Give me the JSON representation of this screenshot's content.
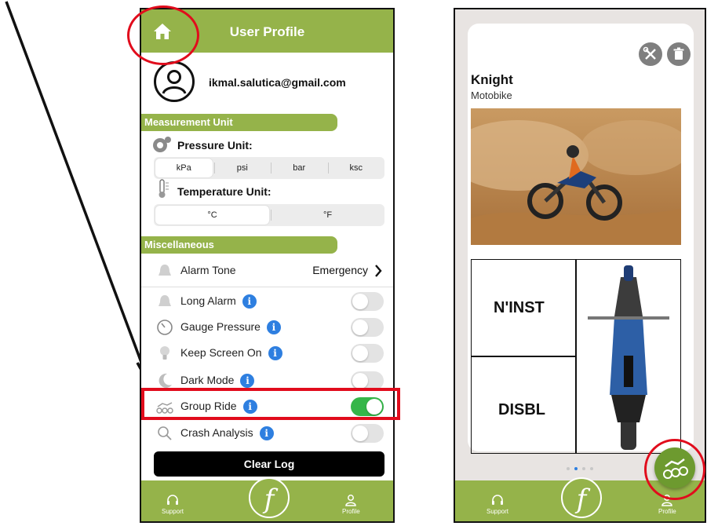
{
  "profile": {
    "header_title": "User Profile",
    "email": "ikmal.salutica@gmail.com",
    "measurement_section": "Measurement Unit",
    "pressure_label": "Pressure Unit:",
    "pressure_options": [
      "kPa",
      "psi",
      "bar",
      "ksc"
    ],
    "pressure_selected": "kPa",
    "temperature_label": "Temperature Unit:",
    "temperature_options": [
      "°C",
      "°F"
    ],
    "temperature_selected": "°C",
    "misc_section": "Miscellaneous",
    "alarm_tone": {
      "label": "Alarm Tone",
      "value": "Emergency"
    },
    "settings": [
      {
        "label": "Long Alarm",
        "on": false
      },
      {
        "label": "Gauge Pressure",
        "on": false
      },
      {
        "label": "Keep Screen On",
        "on": false
      },
      {
        "label": "Dark Mode",
        "on": false
      },
      {
        "label": "Group Ride",
        "on": true
      },
      {
        "label": "Crash Analysis",
        "on": false
      }
    ],
    "clear_log": "Clear Log",
    "info_glyph": "i"
  },
  "nav": {
    "support": "Support",
    "profile": "Profile",
    "logo_letter": "f"
  },
  "vehicle": {
    "name": "Knight",
    "type": "Motobike",
    "status_top": "N'INST",
    "status_bottom": "DISBL",
    "page_count": 4,
    "active_page": 1
  },
  "colors": {
    "brand_green": "#95b34a",
    "toggle_on": "#35b649",
    "info_blue": "#2e7fe0",
    "annotation_red": "#e10c1c"
  },
  "icons": [
    "home-icon",
    "user-avatar-icon",
    "gauge-icon",
    "thermometer-icon",
    "bell-icon",
    "dial-icon",
    "bulb-icon",
    "moon-icon",
    "bikes-icon",
    "magnifier-icon",
    "headset-icon",
    "person-icon",
    "wrench-icon",
    "trash-icon",
    "chevron-right-icon"
  ]
}
